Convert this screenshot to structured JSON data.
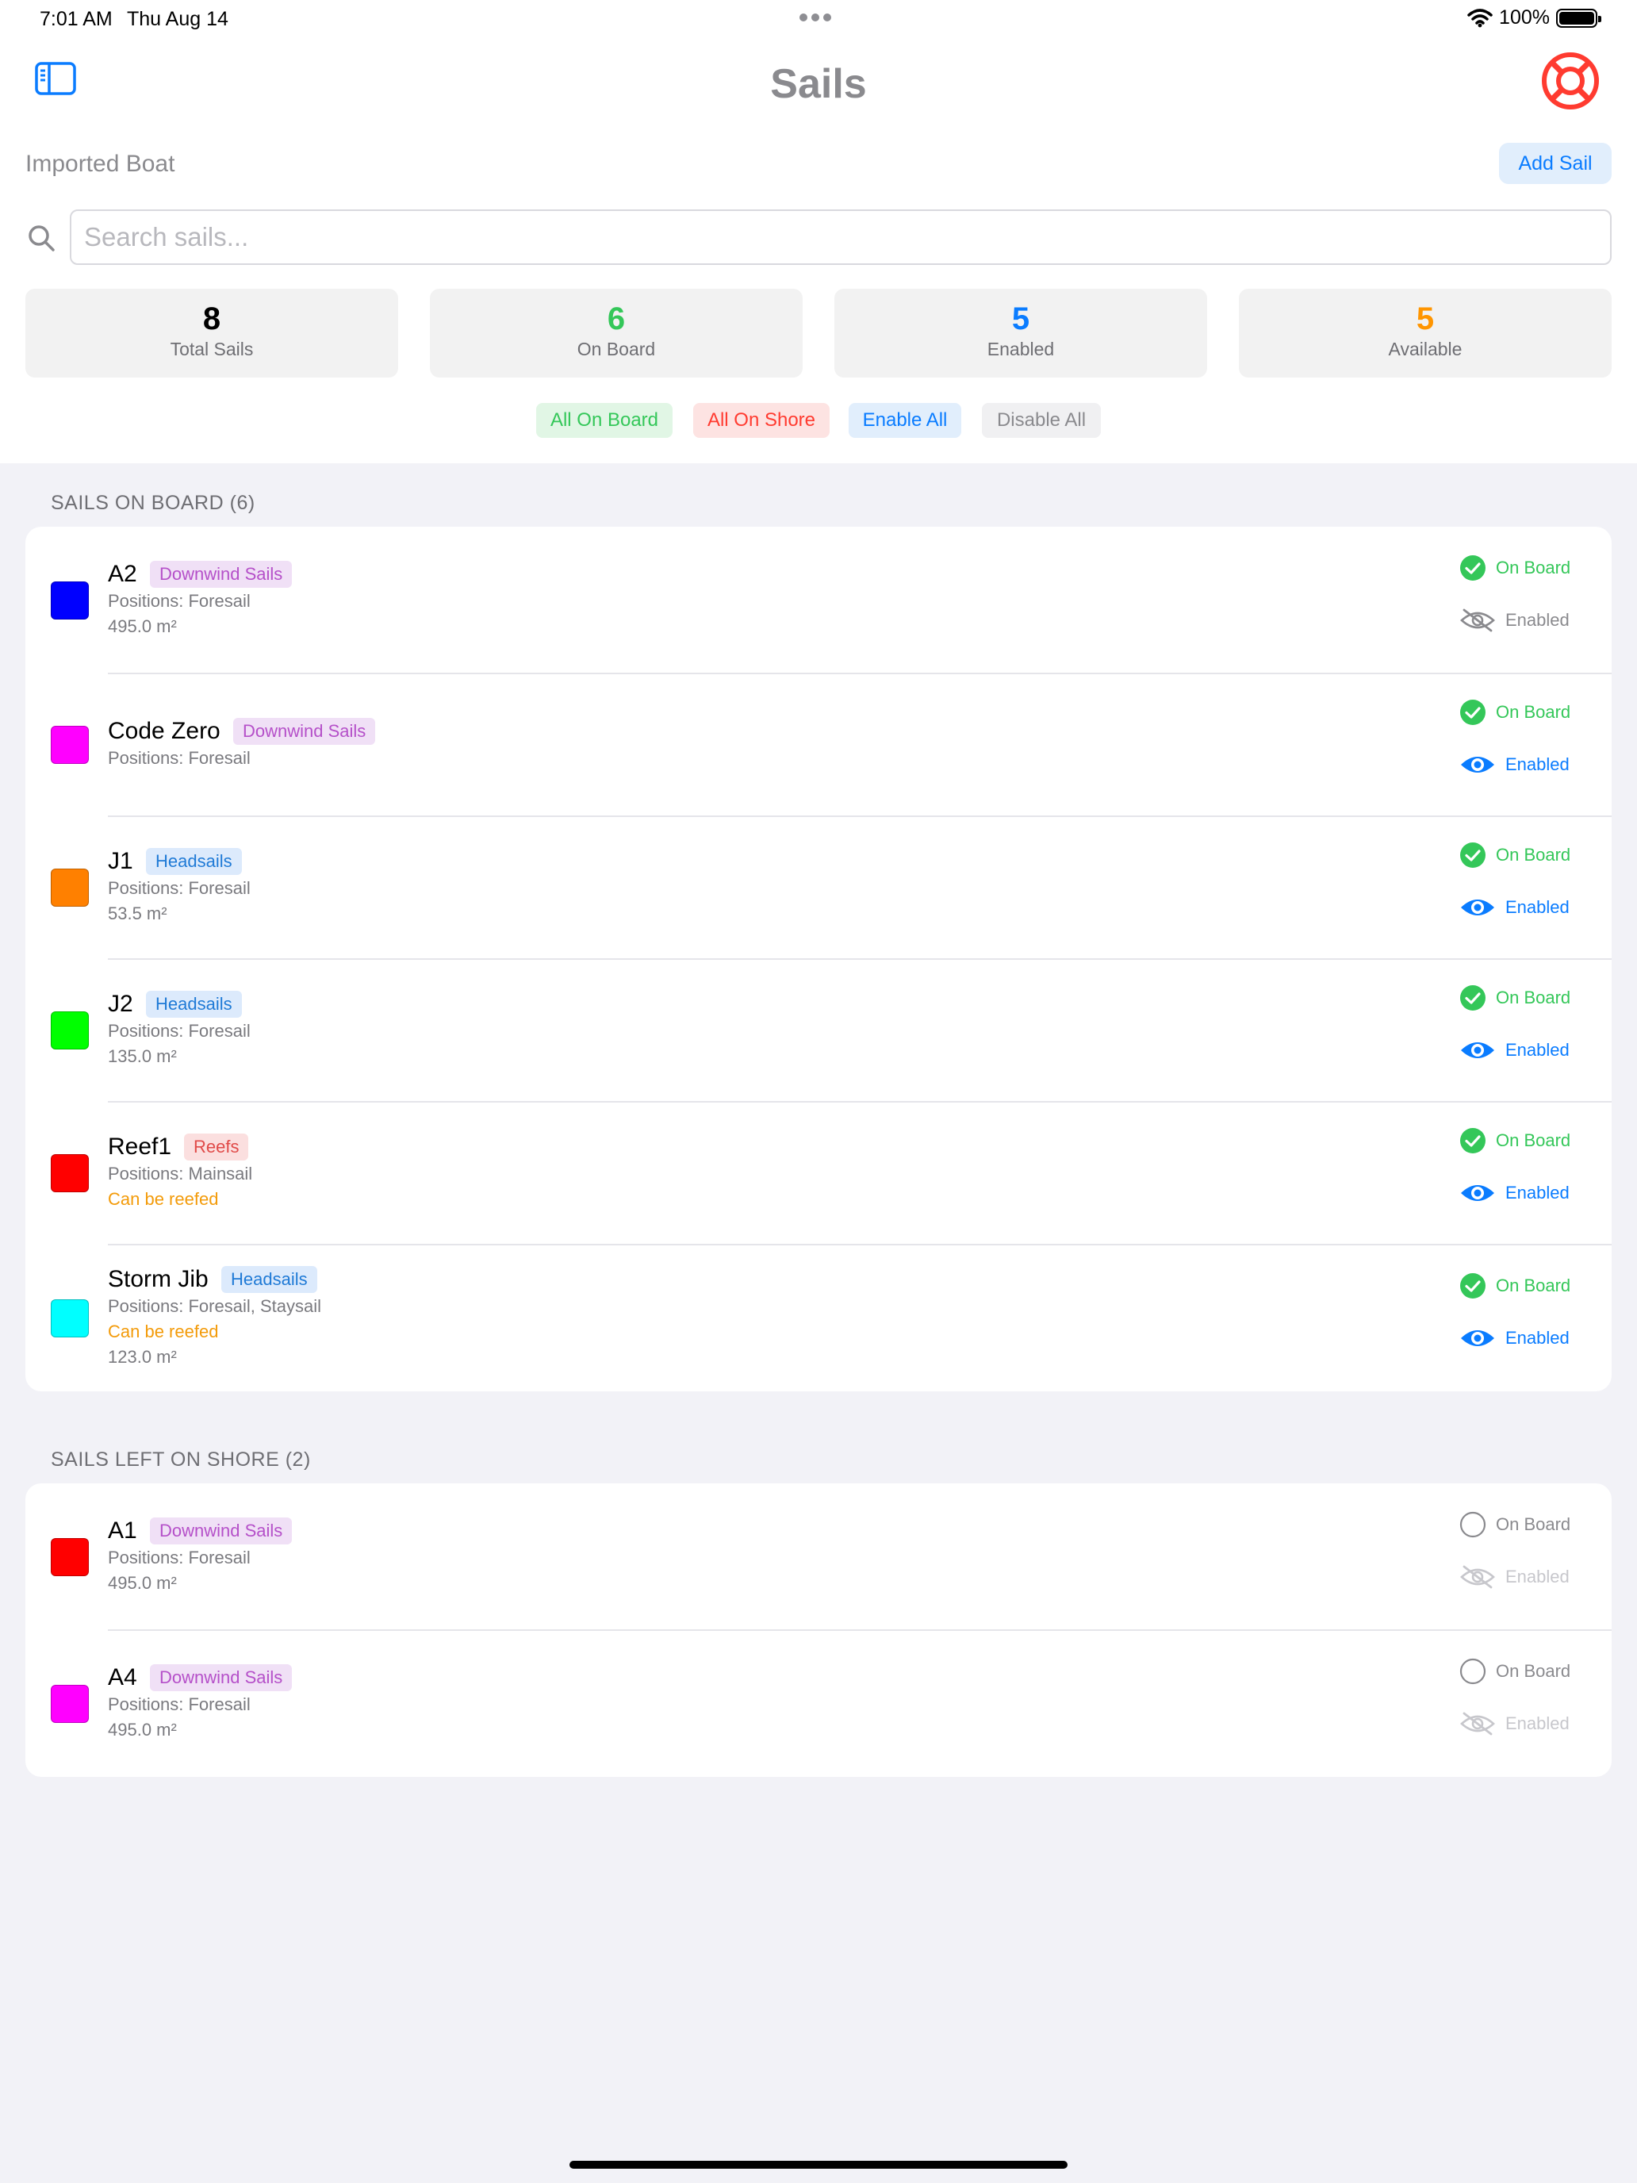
{
  "status_bar": {
    "time": "7:01 AM",
    "date": "Thu Aug 14",
    "battery": "100%"
  },
  "header": {
    "title": "Sails",
    "boat_name": "Imported Boat",
    "add_sail_label": "Add Sail"
  },
  "search": {
    "placeholder": "Search sails..."
  },
  "stats": [
    {
      "value": "8",
      "label": "Total Sails",
      "color": "#000000"
    },
    {
      "value": "6",
      "label": "On Board",
      "color": "#34c759"
    },
    {
      "value": "5",
      "label": "Enabled",
      "color": "#0a7cff"
    },
    {
      "value": "5",
      "label": "Available",
      "color": "#ff9500"
    }
  ],
  "bulk_actions": {
    "all_on_board": "All On Board",
    "all_on_shore": "All On Shore",
    "enable_all": "Enable All",
    "disable_all": "Disable All"
  },
  "sections": {
    "on_board": {
      "title": "SAILS ON BOARD (6)",
      "sails": [
        {
          "name": "A2",
          "category": "Downwind Sails",
          "positions": "Positions: Foresail",
          "reefable": "",
          "area": "495.0 m²",
          "color": "#0000ff",
          "on_board_label": "On Board",
          "on_board": true,
          "enabled_label": "Enabled",
          "enabled": false
        },
        {
          "name": "Code Zero",
          "category": "Downwind Sails",
          "positions": "Positions: Foresail",
          "reefable": "",
          "area": "",
          "color": "#ff00ff",
          "on_board_label": "On Board",
          "on_board": true,
          "enabled_label": "Enabled",
          "enabled": true
        },
        {
          "name": "J1",
          "category": "Headsails",
          "positions": "Positions: Foresail",
          "reefable": "",
          "area": "53.5 m²",
          "color": "#ff8000",
          "on_board_label": "On Board",
          "on_board": true,
          "enabled_label": "Enabled",
          "enabled": true
        },
        {
          "name": "J2",
          "category": "Headsails",
          "positions": "Positions: Foresail",
          "reefable": "",
          "area": "135.0 m²",
          "color": "#00ff00",
          "on_board_label": "On Board",
          "on_board": true,
          "enabled_label": "Enabled",
          "enabled": true
        },
        {
          "name": "Reef1",
          "category": "Reefs",
          "positions": "Positions: Mainsail",
          "reefable": "Can be reefed",
          "area": "",
          "color": "#ff0000",
          "on_board_label": "On Board",
          "on_board": true,
          "enabled_label": "Enabled",
          "enabled": true
        },
        {
          "name": "Storm Jib",
          "category": "Headsails",
          "positions": "Positions: Foresail, Staysail",
          "reefable": "Can be reefed",
          "area": "123.0 m²",
          "color": "#00ffff",
          "on_board_label": "On Board",
          "on_board": true,
          "enabled_label": "Enabled",
          "enabled": true
        }
      ]
    },
    "on_shore": {
      "title": "SAILS LEFT ON SHORE (2)",
      "sails": [
        {
          "name": "A1",
          "category": "Downwind Sails",
          "positions": "Positions: Foresail",
          "reefable": "",
          "area": "495.0 m²",
          "color": "#ff0000",
          "on_board_label": "On Board",
          "on_board": false,
          "enabled_label": "Enabled",
          "enabled": false
        },
        {
          "name": "A4",
          "category": "Downwind Sails",
          "positions": "Positions: Foresail",
          "reefable": "",
          "area": "495.0 m²",
          "color": "#ff00ff",
          "on_board_label": "On Board",
          "on_board": false,
          "enabled_label": "Enabled",
          "enabled": false
        }
      ]
    }
  },
  "icons": {
    "sidebar": "sidebar-toggle-icon",
    "help": "lifebuoy-icon",
    "search": "search-icon",
    "on_board": "checkmark-circle-icon",
    "on_shore": "empty-circle-icon",
    "enabled": "eye-icon",
    "disabled": "eye-slash-icon"
  }
}
